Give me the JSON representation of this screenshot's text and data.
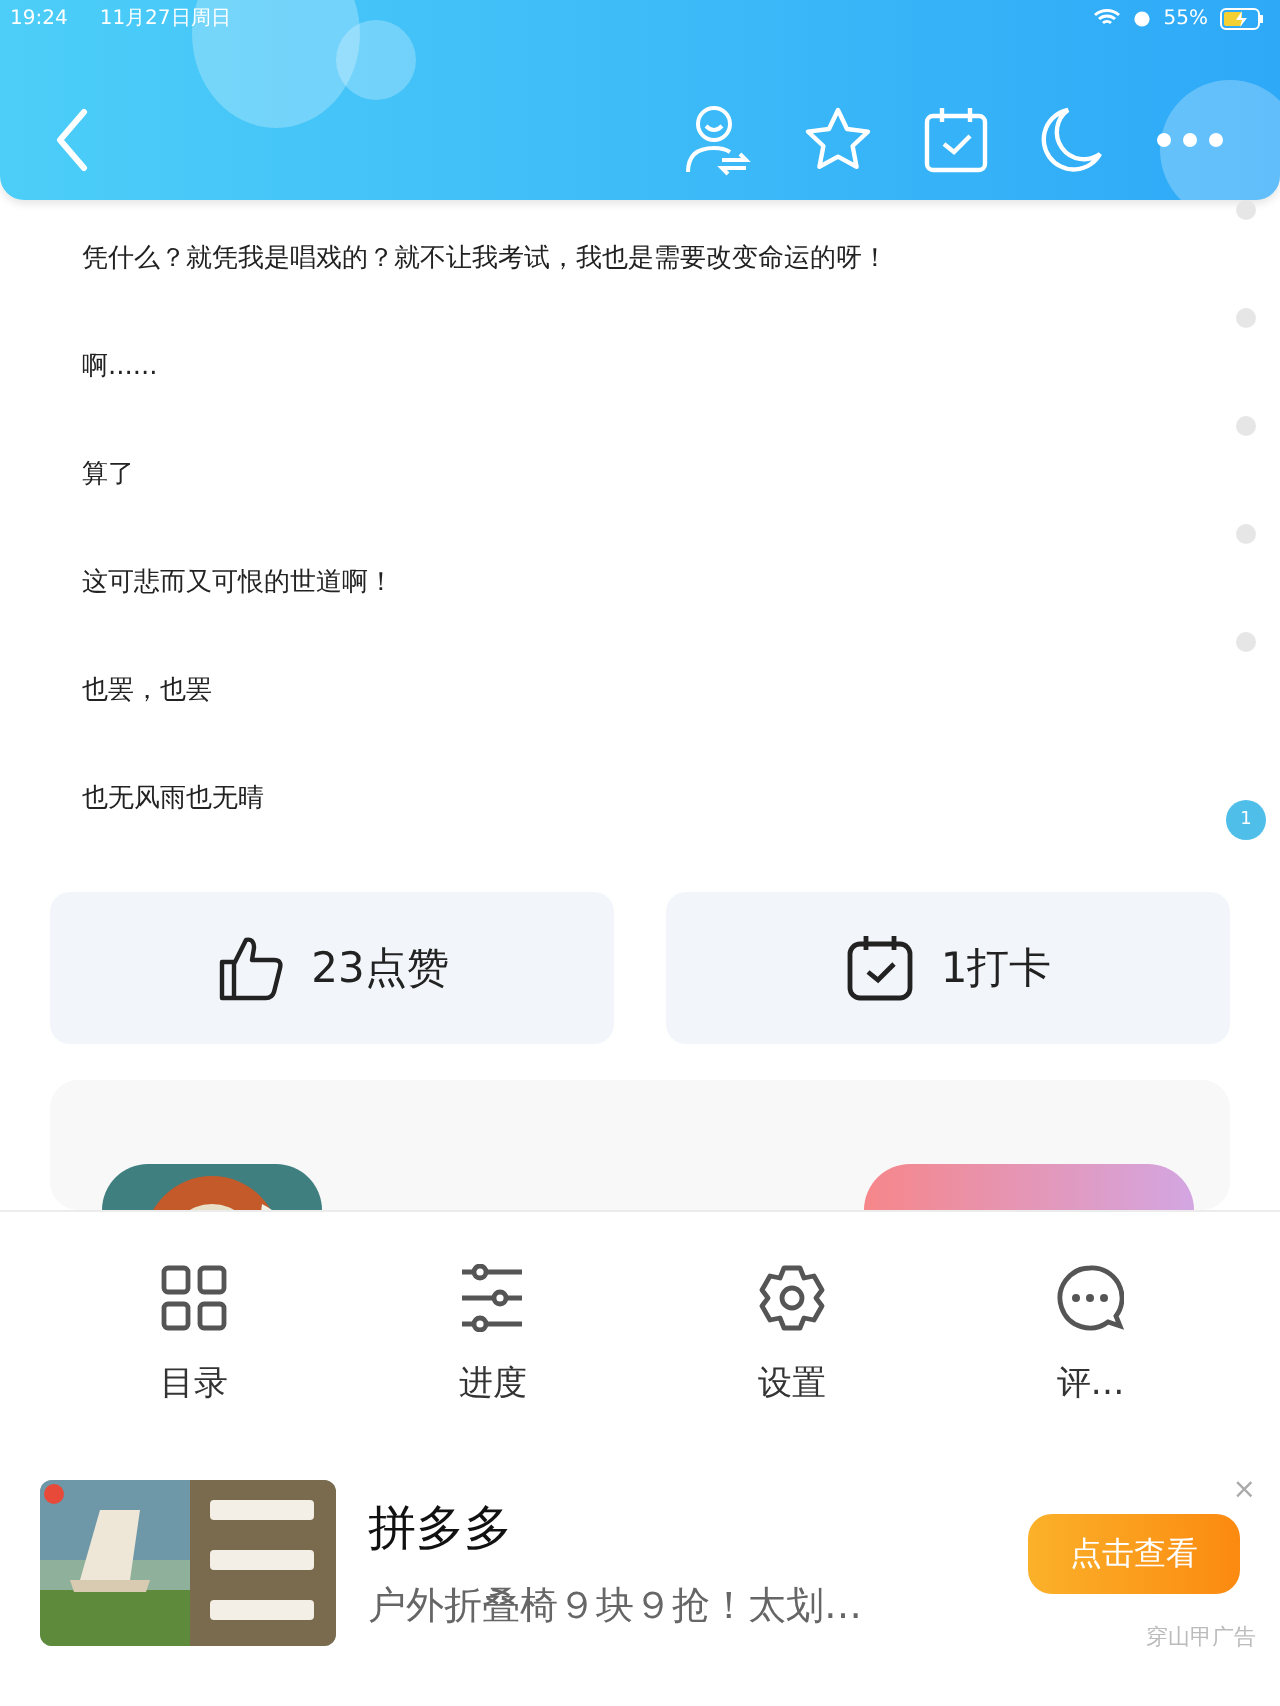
{
  "status_bar": {
    "time": "19:24",
    "date": "11月27日周日",
    "battery": "55%"
  },
  "paragraphs": [
    {
      "text": "凭什么？就凭我是唱戏的？就不让我考试，我也是需要改变命运的呀！"
    },
    {
      "text": "啊......"
    },
    {
      "text": "算了"
    },
    {
      "text": "这可悲而又可恨的世道啊！"
    },
    {
      "text": "也罢，也罢"
    },
    {
      "text": "也无风雨也无晴",
      "comment_count": "1"
    }
  ],
  "actions": [
    {
      "kind": "like",
      "label": "23点赞"
    },
    {
      "kind": "checkin",
      "label": "1打卡"
    }
  ],
  "bottom_menu": [
    {
      "kind": "toc",
      "label": "目录"
    },
    {
      "kind": "progress",
      "label": "进度"
    },
    {
      "kind": "settings",
      "label": "设置"
    },
    {
      "kind": "comments",
      "label": "评…"
    }
  ],
  "ad": {
    "title": "拼多多",
    "description": "户外折叠椅９块９抢！太划…",
    "button": "点击查看",
    "close": "×",
    "source": "穿山甲广告"
  }
}
